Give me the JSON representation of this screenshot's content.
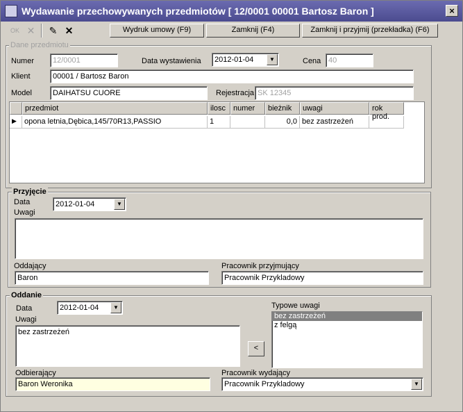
{
  "window": {
    "title": "Wydawanie przechowywanych przedmiotów [ 12/0001 00001 Bartosz Baron ]",
    "close_label": "×"
  },
  "toolbar": {
    "print_label": "Wydruk umowy (F9)",
    "close_label": "Zamknij (F4)",
    "close_accept_label": "Zamknij i przyjmij (przekładka) (F6)",
    "ok_icon_text": "OK"
  },
  "item_group": {
    "legend": "Dane przedmiotu",
    "number_label": "Numer",
    "number_value": "12/0001",
    "date_label": "Data wystawienia",
    "date_value": "2012-01-04",
    "price_label": "Cena",
    "price_value": "40",
    "client_label": "Klient",
    "client_value": "00001 / Bartosz Baron",
    "model_label": "Model",
    "model_value": "DAIHATSU CUORE",
    "reg_label": "Rejestracja",
    "reg_value": "SK 12345"
  },
  "table": {
    "headers": [
      "przedmiot",
      "ilosc",
      "numer",
      "bieżnik",
      "uwagi",
      "rok prod."
    ],
    "rows": [
      [
        "opona letnia,Dębica,145/70R13,PASSIO",
        "1",
        "",
        "0,0",
        "bez zastrzeżeń",
        ""
      ]
    ]
  },
  "receive": {
    "legend": "Przyjęcie",
    "date_label": "Data",
    "date_value": "2012-01-04",
    "notes_label": "Uwagi",
    "notes_value": "",
    "giver_label": "Oddający",
    "giver_value": "Baron",
    "worker_label": "Pracownik przyjmujący",
    "worker_value": "Pracownik Przykladowy"
  },
  "release": {
    "legend": "Oddanie",
    "date_label": "Data",
    "date_value": "2012-01-04",
    "notes_label": "Uwagi",
    "notes_value": "bez zastrzeżeń",
    "typical_label": "Typowe uwagi",
    "typical_items": [
      "bez zastrzeżeń",
      "z felgą"
    ],
    "move_button": "<",
    "receiver_label": "Odbierający",
    "receiver_value": "Baron Weronika",
    "worker_label": "Pracownik wydający",
    "worker_value": "Pracownik Przykladowy"
  }
}
